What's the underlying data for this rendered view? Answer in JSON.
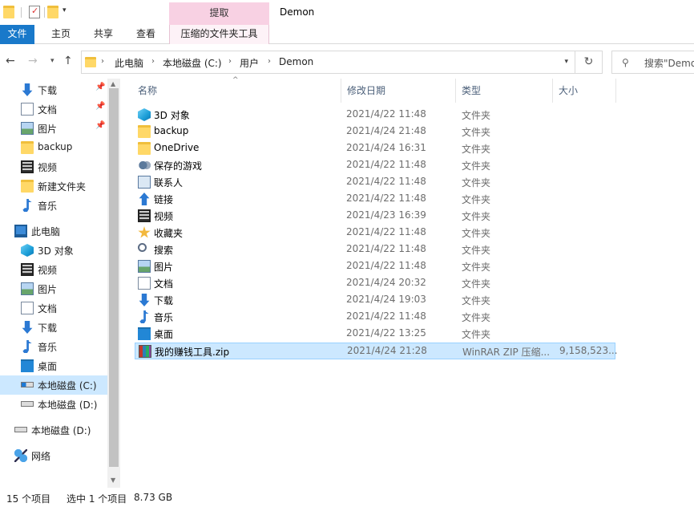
{
  "window": {
    "title": "Demon",
    "context_tab_title": "提取"
  },
  "ribbon": {
    "tabs": [
      "文件",
      "主页",
      "共享",
      "查看",
      "压缩的文件夹工具"
    ]
  },
  "address": {
    "crumbs": [
      "此电脑",
      "本地磁盘 (C:)",
      "用户",
      "Demon"
    ]
  },
  "search": {
    "placeholder": "搜索\"Demo"
  },
  "navpane": {
    "items": [
      {
        "label": "下载",
        "icon": "download-icon",
        "pinned": true
      },
      {
        "label": "文档",
        "icon": "document-icon",
        "pinned": true
      },
      {
        "label": "图片",
        "icon": "picture-icon",
        "pinned": true
      },
      {
        "label": "backup",
        "icon": "folder-icon",
        "pinned": false
      },
      {
        "label": "视频",
        "icon": "video-icon",
        "pinned": false
      },
      {
        "label": "新建文件夹",
        "icon": "folder-icon",
        "pinned": false
      },
      {
        "label": "音乐",
        "icon": "music-icon",
        "pinned": false
      },
      {
        "label": "此电脑",
        "icon": "computer-icon",
        "pinned": false
      },
      {
        "label": "3D 对象",
        "icon": "3d-objects-icon",
        "pinned": false
      },
      {
        "label": "视频",
        "icon": "video-icon",
        "pinned": false
      },
      {
        "label": "图片",
        "icon": "picture-icon",
        "pinned": false
      },
      {
        "label": "文档",
        "icon": "document-icon",
        "pinned": false
      },
      {
        "label": "下载",
        "icon": "download-icon",
        "pinned": false
      },
      {
        "label": "音乐",
        "icon": "music-icon",
        "pinned": false
      },
      {
        "label": "桌面",
        "icon": "desktop-icon",
        "pinned": false
      },
      {
        "label": "本地磁盘 (C:)",
        "icon": "drive-c-icon",
        "pinned": false,
        "selected": true
      },
      {
        "label": "本地磁盘 (D:)",
        "icon": "drive-icon",
        "pinned": false
      },
      {
        "label": "本地磁盘 (D:)",
        "icon": "drive-icon",
        "pinned": false
      },
      {
        "label": "网络",
        "icon": "network-icon",
        "pinned": false
      }
    ]
  },
  "columns": {
    "name": "名称",
    "date": "修改日期",
    "type": "类型",
    "size": "大小"
  },
  "files": [
    {
      "name": "3D 对象",
      "date": "2021/4/22 11:48",
      "type": "文件夹",
      "size": "",
      "icon": "3d-objects-icon"
    },
    {
      "name": "backup",
      "date": "2021/4/24 21:48",
      "type": "文件夹",
      "size": "",
      "icon": "folder-icon"
    },
    {
      "name": "OneDrive",
      "date": "2021/4/24 16:31",
      "type": "文件夹",
      "size": "",
      "icon": "folder-icon"
    },
    {
      "name": "保存的游戏",
      "date": "2021/4/22 11:48",
      "type": "文件夹",
      "size": "",
      "icon": "saved-games-icon"
    },
    {
      "name": "联系人",
      "date": "2021/4/22 11:48",
      "type": "文件夹",
      "size": "",
      "icon": "contacts-icon"
    },
    {
      "name": "链接",
      "date": "2021/4/22 11:48",
      "type": "文件夹",
      "size": "",
      "icon": "links-icon"
    },
    {
      "name": "视频",
      "date": "2021/4/23 16:39",
      "type": "文件夹",
      "size": "",
      "icon": "video-icon"
    },
    {
      "name": "收藏夹",
      "date": "2021/4/22 11:48",
      "type": "文件夹",
      "size": "",
      "icon": "favorites-icon"
    },
    {
      "name": "搜索",
      "date": "2021/4/22 11:48",
      "type": "文件夹",
      "size": "",
      "icon": "searches-icon"
    },
    {
      "name": "图片",
      "date": "2021/4/22 11:48",
      "type": "文件夹",
      "size": "",
      "icon": "picture-icon"
    },
    {
      "name": "文档",
      "date": "2021/4/24 20:32",
      "type": "文件夹",
      "size": "",
      "icon": "document-icon"
    },
    {
      "name": "下载",
      "date": "2021/4/24 19:03",
      "type": "文件夹",
      "size": "",
      "icon": "download-icon"
    },
    {
      "name": "音乐",
      "date": "2021/4/22 11:48",
      "type": "文件夹",
      "size": "",
      "icon": "music-icon"
    },
    {
      "name": "桌面",
      "date": "2021/4/22 13:25",
      "type": "文件夹",
      "size": "",
      "icon": "desktop-icon"
    },
    {
      "name": "我的赚钱工具.zip",
      "date": "2021/4/24 21:28",
      "type": "WinRAR ZIP 压缩...",
      "size": "9,158,523...",
      "icon": "winrar-zip-icon",
      "selected": true
    }
  ],
  "status": {
    "count": "15 个项目",
    "selection": "选中 1 个项目",
    "size": "8.73 GB"
  },
  "colors": {
    "accent": "#1979ca",
    "selection": "#cce8ff",
    "context_tab": "#f8d1e3"
  }
}
